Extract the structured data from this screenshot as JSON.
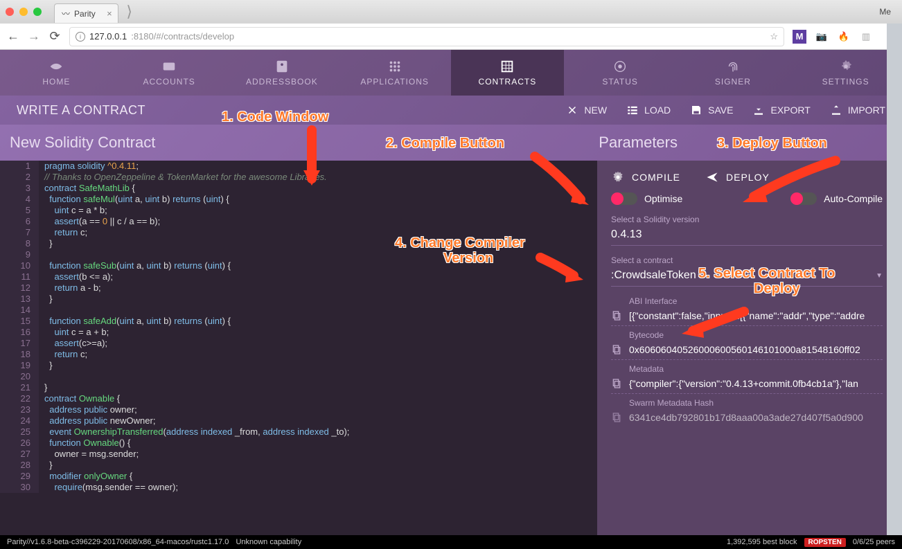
{
  "browser": {
    "tab_title": "Parity",
    "url_host": "127.0.0.1",
    "url_port_path": ":8180/#/contracts/develop",
    "profile": "Me"
  },
  "nav": {
    "items": [
      {
        "label": "HOME"
      },
      {
        "label": "ACCOUNTS"
      },
      {
        "label": "ADDRESSBOOK"
      },
      {
        "label": "APPLICATIONS"
      },
      {
        "label": "CONTRACTS"
      },
      {
        "label": "STATUS"
      },
      {
        "label": "SIGNER"
      },
      {
        "label": "SETTINGS"
      }
    ]
  },
  "page": {
    "title": "WRITE A CONTRACT",
    "actions": [
      {
        "label": "NEW"
      },
      {
        "label": "LOAD"
      },
      {
        "label": "SAVE"
      },
      {
        "label": "EXPORT"
      },
      {
        "label": "IMPORT"
      }
    ],
    "subtitle": "New Solidity Contract",
    "params_title": "Parameters"
  },
  "params": {
    "compile": "COMPILE",
    "deploy": "DEPLOY",
    "optimise": "Optimise",
    "autocompile": "Auto-Compile",
    "select_version_label": "Select a Solidity version",
    "select_version": "0.4.13",
    "select_contract_label": "Select a contract",
    "select_contract": ":CrowdsaleToken",
    "abi_label": "ABI Interface",
    "abi": "[{\"constant\":false,\"inputs\":[{\"name\":\"addr\",\"type\":\"addre",
    "bytecode_label": "Bytecode",
    "bytecode": "0x60606040526000600560146101000a81548160ff02",
    "metadata_label": "Metadata",
    "metadata": "{\"compiler\":{\"version\":\"0.4.13+commit.0fb4cb1a\"},\"lan",
    "swarm_label": "Swarm Metadata Hash",
    "swarm": "6341ce4db792801b17d8aaa00a3ade27d407f5a0d900"
  },
  "code_lines": [
    "pragma solidity ^0.4.11;",
    "// Thanks to OpenZeppeline & TokenMarket for the awesome Libraries.",
    "contract SafeMathLib {",
    "  function safeMul(uint a, uint b) returns (uint) {",
    "    uint c = a * b;",
    "    assert(a == 0 || c / a == b);",
    "    return c;",
    "  }",
    "",
    "  function safeSub(uint a, uint b) returns (uint) {",
    "    assert(b <= a);",
    "    return a - b;",
    "  }",
    "",
    "  function safeAdd(uint a, uint b) returns (uint) {",
    "    uint c = a + b;",
    "    assert(c>=a);",
    "    return c;",
    "  }",
    "",
    "}",
    "contract Ownable {",
    "  address public owner;",
    "  address public newOwner;",
    "  event OwnershipTransferred(address indexed _from, address indexed _to);",
    "  function Ownable() {",
    "    owner = msg.sender;",
    "  }",
    "  modifier onlyOwner {",
    "    require(msg.sender == owner);"
  ],
  "status": {
    "left": "Parity//v1.6.8-beta-c396229-20170608/x86_64-macos/rustc1.17.0",
    "capability": "Unknown capability",
    "best_block": "1,392,595 best block",
    "network": "ROPSTEN",
    "peers": "0/6/25 peers"
  },
  "annotations": {
    "a1": "1. Code Window",
    "a2": "2. Compile Button",
    "a3": "3. Deploy Button",
    "a4": "4. Change Compiler",
    "a4b": "Version",
    "a5": "5. Select Contract To",
    "a5b": "Deploy"
  }
}
